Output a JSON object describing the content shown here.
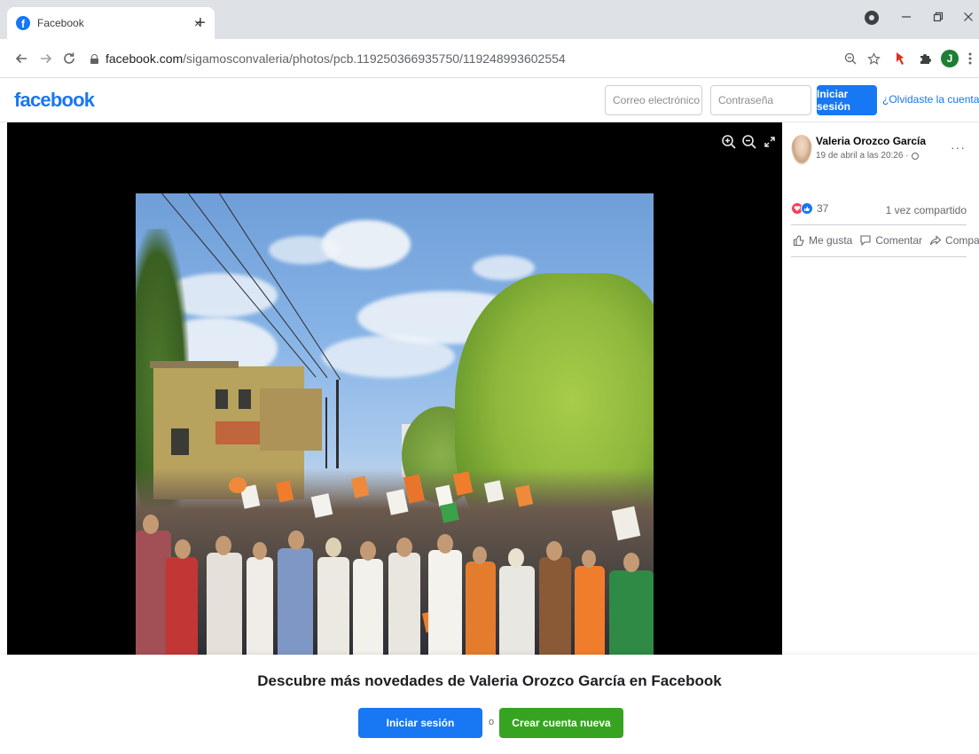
{
  "browser": {
    "tab_title": "Facebook",
    "tab_close": "×",
    "new_tab": "+",
    "url_domain": "facebook.com",
    "url_path": "/sigamosconvaleria/photos/pcb.119250366935750/119248993602554",
    "profile_initial": "J",
    "icons": [
      "back-icon",
      "forward-icon",
      "reload-icon",
      "lock-icon",
      "zoom-icon",
      "star-icon",
      "extension-icon",
      "puzzle-icon",
      "menu-icon"
    ]
  },
  "fb_header": {
    "logo": "facebook",
    "email_placeholder": "Correo electrónico o teléfono",
    "password_placeholder": "Contraseña",
    "login_button": "Iniciar sesión",
    "forgot_link": "¿Olvidaste la cuenta?",
    "brand_color": "#1877f2"
  },
  "post": {
    "author": "Valeria Orozco García",
    "date": "19 de abril a las 20:26 ·",
    "more": "···",
    "reaction_count": "37",
    "shares": "1 vez compartido",
    "actions": {
      "like": "Me gusta",
      "comment": "Comentar",
      "share": "Compartir"
    }
  },
  "banner": {
    "title": "Descubre más novedades de Valeria Orozco García en Facebook",
    "login_button": "Iniciar sesión",
    "or_text": "o",
    "create_button": "Crear cuenta nueva",
    "create_color": "#36a420"
  }
}
